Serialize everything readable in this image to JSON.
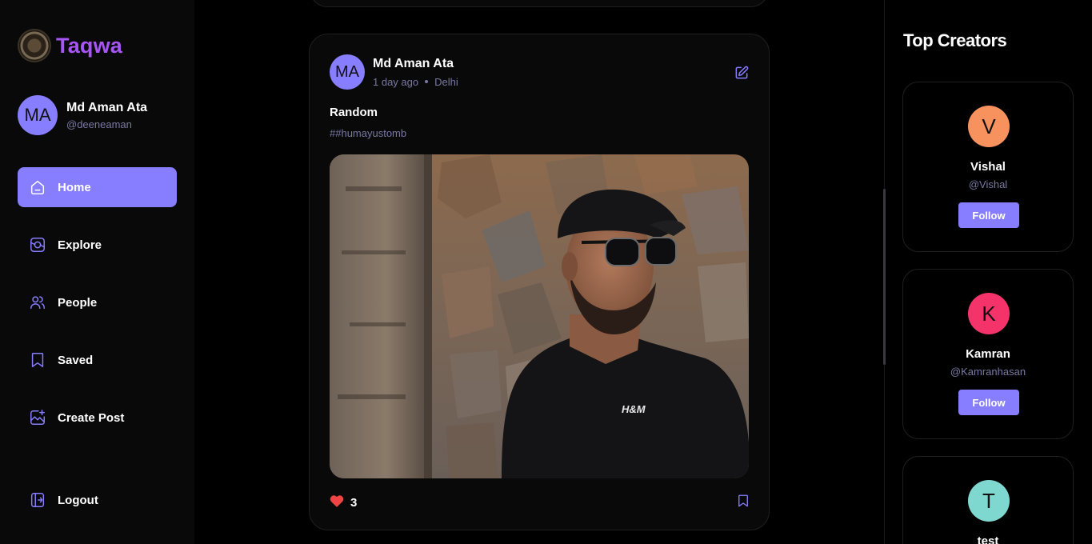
{
  "brand": {
    "name": "Taqwa",
    "logo_icon": "mosque-emblem-icon"
  },
  "user": {
    "initials": "MA",
    "name": "Md Aman Ata",
    "handle": "@deeneaman"
  },
  "nav": {
    "items": [
      {
        "label": "Home",
        "icon": "home-icon",
        "active": true
      },
      {
        "label": "Explore",
        "icon": "explore-icon",
        "active": false
      },
      {
        "label": "People",
        "icon": "people-icon",
        "active": false
      },
      {
        "label": "Saved",
        "icon": "bookmark-icon",
        "active": false
      },
      {
        "label": "Create Post",
        "icon": "add-image-icon",
        "active": false
      }
    ],
    "logout_label": "Logout"
  },
  "post": {
    "author_initials": "MA",
    "author_name": "Md Aman Ata",
    "time": "1 day ago",
    "location": "Delhi",
    "caption": "Random",
    "tags": "##humayustomb",
    "image_alt": "Man in black cap and sunglasses leaning against stone wall",
    "shirt_logo": "H&M",
    "likes": "3"
  },
  "right_panel": {
    "title": "Top Creators",
    "creators": [
      {
        "initial": "V",
        "name": "Vishal",
        "handle": "@Vishal",
        "follow_label": "Follow",
        "color": "#f7925f"
      },
      {
        "initial": "K",
        "name": "Kamran",
        "handle": "@Kamranhasan",
        "follow_label": "Follow",
        "color": "#f4336b"
      },
      {
        "initial": "T",
        "name": "test",
        "handle": "",
        "follow_label": "",
        "color": "#7fd8cf"
      }
    ]
  },
  "colors": {
    "accent": "#877eff",
    "brand": "#a855f7",
    "muted": "#7878a3",
    "like": "#ef4444"
  }
}
